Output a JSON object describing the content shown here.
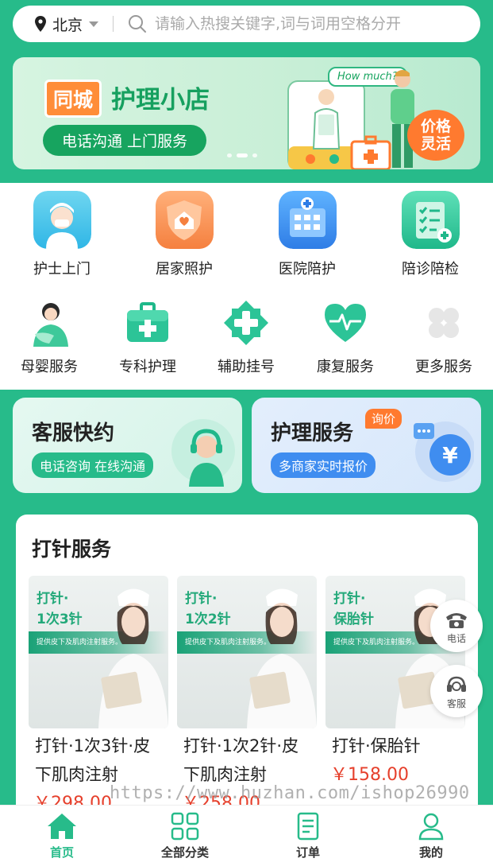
{
  "search": {
    "city": "北京",
    "placeholder": "请输入热搜关键字,词与词用空格分开"
  },
  "banner": {
    "tag": "同城",
    "title": "护理小店",
    "subtitle": "电话沟通 上门服务",
    "bubble": "How much?",
    "price_badge_line1": "价格",
    "price_badge_line2": "灵活"
  },
  "categories_row1": [
    {
      "label": "护士上门",
      "icon": "nurse-icon"
    },
    {
      "label": "居家照护",
      "icon": "home-care-icon"
    },
    {
      "label": "医院陪护",
      "icon": "hospital-icon"
    },
    {
      "label": "陪诊陪检",
      "icon": "checklist-icon"
    }
  ],
  "categories_row2": [
    {
      "label": "母婴服务",
      "icon": "mother-baby-icon"
    },
    {
      "label": "专科护理",
      "icon": "medical-kit-icon"
    },
    {
      "label": "辅助挂号",
      "icon": "cross-icon"
    },
    {
      "label": "康复服务",
      "icon": "heartbeat-icon"
    },
    {
      "label": "更多服务",
      "icon": "more-icon"
    }
  ],
  "cards": [
    {
      "title": "客服快约",
      "pill": "电话咨询 在线沟通"
    },
    {
      "title": "护理服务",
      "pill": "多商家实时报价",
      "badge": "询价"
    }
  ],
  "service": {
    "title": "打针服务",
    "products": [
      {
        "img_title_1": "打针·",
        "img_title_2": "1次3针",
        "strip": "提供皮下及肌肉注射服务。",
        "name_1": "打针·1次3针·皮",
        "name_2": "下肌肉注射",
        "price": "￥298.00"
      },
      {
        "img_title_1": "打针·",
        "img_title_2": "1次2针",
        "strip": "提供皮下及肌肉注射服务。",
        "name_1": "打针·1次2针·皮",
        "name_2": "下肌肉注射",
        "price": "￥258.00"
      },
      {
        "img_title_1": "打针·",
        "img_title_2": "保胎针",
        "strip": "提供皮下及肌肉注射服务。",
        "name_1": "打针·保胎针",
        "name_2": "",
        "price": "￥158.00"
      }
    ]
  },
  "float": {
    "phone": "电话",
    "service": "客服"
  },
  "watermark": "https://www.huzhan.com/ishop26990",
  "tabbar": [
    {
      "label": "首页",
      "icon": "home-icon",
      "active": true
    },
    {
      "label": "全部分类",
      "icon": "grid-icon",
      "active": false
    },
    {
      "label": "订单",
      "icon": "order-icon",
      "active": false
    },
    {
      "label": "我的",
      "icon": "user-icon",
      "active": false
    }
  ],
  "colors": {
    "brand": "#27bb8a",
    "price": "#e6402c",
    "accent_orange": "#ff8d38"
  }
}
